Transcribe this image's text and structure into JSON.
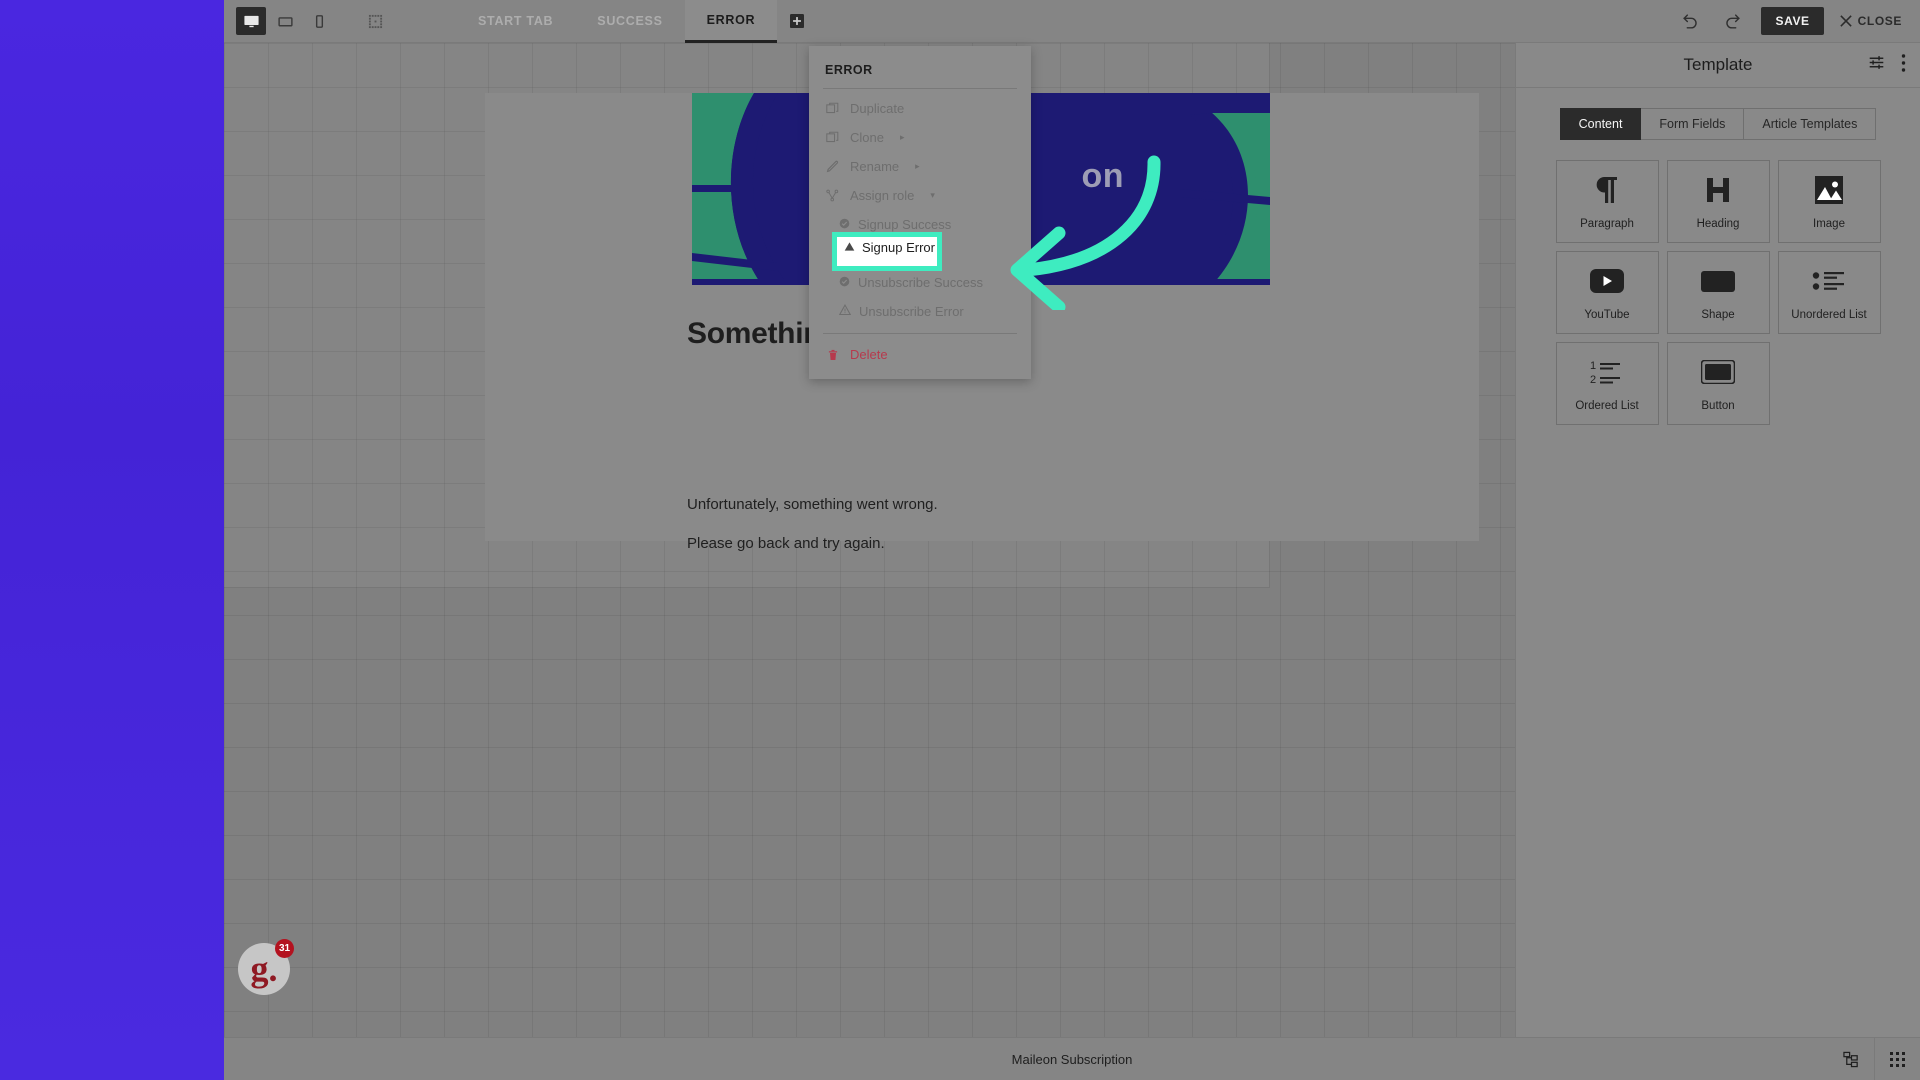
{
  "toolbar": {
    "devices": [
      {
        "name": "desktop-view",
        "icon": "monitor-icon",
        "active": true
      },
      {
        "name": "tablet-view",
        "icon": "tablet-icon",
        "active": false
      },
      {
        "name": "mobile-view",
        "icon": "phone-icon",
        "active": false
      },
      {
        "name": "grid-view",
        "icon": "dotted-square-icon",
        "active": false
      }
    ],
    "tabs": [
      {
        "label": "START TAB",
        "active": false
      },
      {
        "label": "SUCCESS",
        "active": false
      },
      {
        "label": "ERROR",
        "active": true
      }
    ],
    "add_tab_icon": "plus-square-icon",
    "undo_icon": "undo-icon",
    "redo_icon": "redo-icon",
    "save_label": "SAVE",
    "close_label": "CLOSE",
    "close_icon": "close-x-icon"
  },
  "context_menu": {
    "title": "ERROR",
    "items": [
      {
        "label": "Duplicate",
        "icon": "duplicate-icon",
        "caret": ""
      },
      {
        "label": "Clone",
        "icon": "clone-icon",
        "caret": "▸"
      },
      {
        "label": "Rename",
        "icon": "pencil-icon",
        "caret": "▸"
      },
      {
        "label": "Assign role",
        "icon": "assign-role-icon",
        "caret": "▾"
      }
    ],
    "roles": [
      {
        "label": "Signup Success",
        "icon": "check-circle-icon",
        "highlighted": false
      },
      {
        "label": "Signup Error",
        "icon": "warning-triangle-icon",
        "highlighted": true
      },
      {
        "label": "Unsubscribe Success",
        "icon": "check-circle-icon",
        "highlighted": false
      },
      {
        "label": "Unsubscribe Error",
        "icon": "warning-triangle-icon",
        "highlighted": false
      }
    ],
    "delete_label": "Delete",
    "delete_icon": "trash-icon"
  },
  "email": {
    "hero_word": "on",
    "heading": "Something went wrong..",
    "paragraph_1": "Unfortunately, something went wrong.",
    "paragraph_2": "Please go back and try again."
  },
  "chat_widget": {
    "logo": "g.",
    "badge_count": "31"
  },
  "sidebar": {
    "title": "Template",
    "settings_icon": "sliders-icon",
    "more_icon": "more-vertical-icon",
    "tabs": [
      {
        "label": "Content",
        "active": true
      },
      {
        "label": "Form Fields",
        "active": false
      },
      {
        "label": "Article Templates",
        "active": false
      }
    ],
    "blocks": [
      {
        "label": "Paragraph",
        "icon": "pilcrow-icon"
      },
      {
        "label": "Heading",
        "icon": "heading-h-icon"
      },
      {
        "label": "Image",
        "icon": "image-icon"
      },
      {
        "label": "YouTube",
        "icon": "youtube-icon"
      },
      {
        "label": "Shape",
        "icon": "shape-rect-icon"
      },
      {
        "label": "Unordered List",
        "icon": "unordered-list-icon"
      },
      {
        "label": "Ordered List",
        "icon": "ordered-list-icon"
      },
      {
        "label": "Button",
        "icon": "button-icon"
      }
    ]
  },
  "bottombar": {
    "title": "Maileon Subscription",
    "structure_icon": "structure-tree-icon",
    "grid_icon": "grid-dots-icon"
  },
  "annotation": {
    "arrow_color": "#3eecc0",
    "highlight_color": "#3eecc0"
  },
  "colors": {
    "accent_mint": "#3eecc0",
    "brand_purple": "#4423d6",
    "hero_navy": "#1d1a73",
    "hero_green": "#2e8f6e",
    "danger_red": "#b63a4d"
  }
}
